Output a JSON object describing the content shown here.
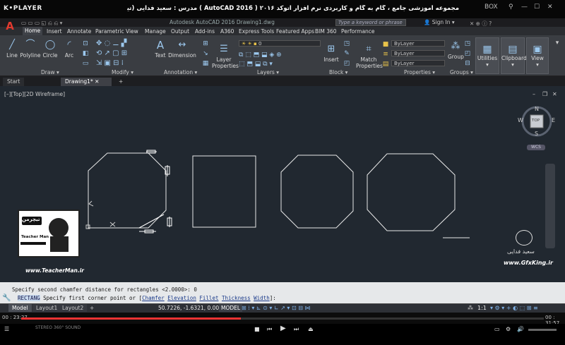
{
  "player": {
    "logo": "K•PLAYER",
    "title": "مجموعه آموزشی جامع ، گام به گام و کاربردی نرم افزار  اتوکد ۲۰۱۶ ( AutoCAD  2016 )  مدرس : سعید فدایی (تیچرمن ) گروه آموزشی پادشاه گرافیست ها",
    "box_label": "BOX",
    "elapsed": "00 : 23:27",
    "remaining": "00 : 31:57",
    "progress_fraction": 0.42,
    "tags": [
      "STEREO",
      "360° SOUND"
    ]
  },
  "autocad": {
    "doc_title": "Autodesk AutoCAD 2016   Drawing1.dwg",
    "search_placeholder": "Type a keyword or phrase",
    "sign_in": "Sign In",
    "ribbon_tabs": [
      "Home",
      "Insert",
      "Annotate",
      "Parametric",
      "View",
      "Manage",
      "Output",
      "Add-ins",
      "A360",
      "Express Tools",
      "Featured Apps",
      "BIM 360",
      "Performance"
    ],
    "active_tab": "Home",
    "draw_tools": [
      "Line",
      "Polyline",
      "Circle",
      "Arc"
    ],
    "panels": {
      "draw": "Draw",
      "modify": "Modify",
      "annotation": "Annotation",
      "layers": "Layers",
      "block": "Block",
      "properties": "Properties",
      "groups": "Groups"
    },
    "annotation_tools": [
      "Text",
      "Dimension"
    ],
    "layer_tools": [
      "Layer Properties"
    ],
    "layer_current": "0",
    "block_tool": "Insert",
    "props_tool": "Match Properties",
    "by_layer": [
      "ByLayer",
      "ByLayer",
      "ByLayer"
    ],
    "group_tool": "Group",
    "side_tools": [
      "Utilities",
      "Clipboard",
      "View"
    ],
    "doc_tabs": [
      "Start",
      "Drawing1*"
    ],
    "viewport_label": "[–][Top][2D Wireframe]",
    "viewcube": {
      "n": "N",
      "s": "S",
      "e": "E",
      "w": "W",
      "face": "TOP"
    },
    "wcs": "WCS",
    "command_history": "Specify second chamfer distance for rectangles <2.0000>: 0",
    "command_prompt": {
      "keyword": "RECTANG",
      "text_before": "Specify first corner point or [",
      "options": [
        "Chamfer",
        "Elevation",
        "Fillet",
        "Thickness",
        "Width"
      ],
      "text_after": "]:"
    },
    "layout_tabs": [
      "Model",
      "Layout1",
      "Layout2"
    ],
    "add_layout": "+",
    "coordinates": "50.7226, -1.6321, 0.0000",
    "model_button": "MODEL",
    "scale": "1:1"
  },
  "watermarks": {
    "left_logo_text": "تیچرمن",
    "left_logo_sub": "Teacher Man",
    "left_url": "www.TeacherMan.ir",
    "right_signature": "سعید فدایی",
    "right_url": "www.GfxKing.ir"
  }
}
